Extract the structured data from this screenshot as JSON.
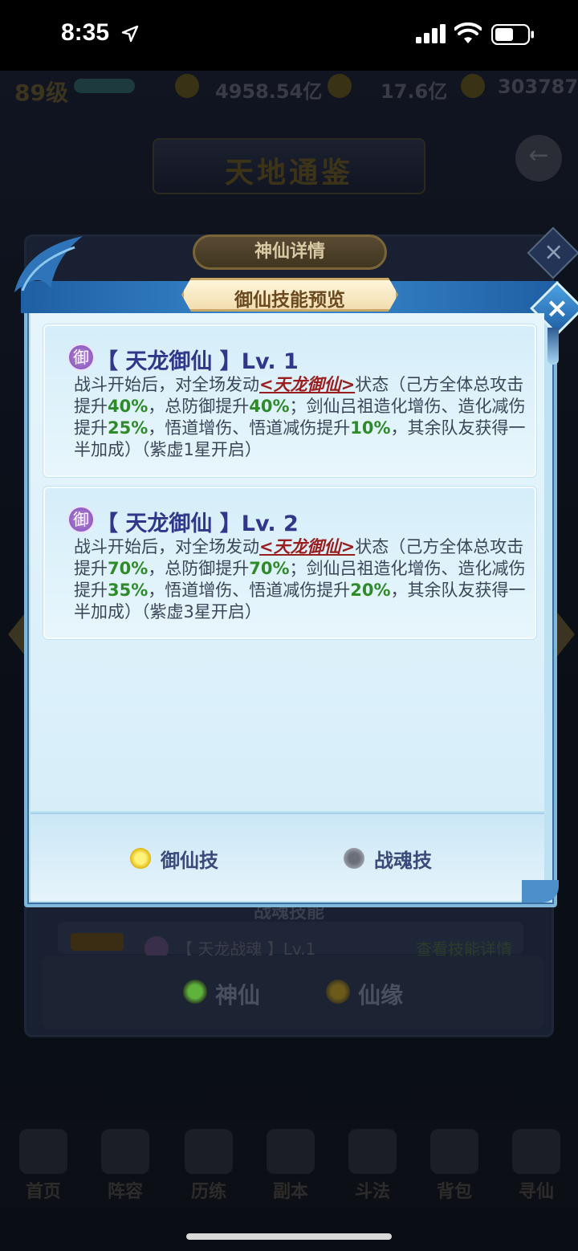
{
  "status_bar": {
    "time": "8:35",
    "icons": [
      "location-arrow-icon",
      "cellular-signal-icon",
      "wifi-icon",
      "battery-icon"
    ]
  },
  "hud": {
    "level": "89级",
    "gold": "4958.54亿",
    "currency2": "17.6亿",
    "currency3": "303787"
  },
  "background_screen": {
    "title": "天地通鉴",
    "dialog_title": "神仙详情",
    "section_title": "战魂技能",
    "row_badge": "战",
    "row_label": "【 天龙战魂 】Lv.1",
    "row_link": "查看技能详情",
    "tabs": [
      {
        "label": "神仙",
        "active": true
      },
      {
        "label": "仙缘",
        "active": false
      }
    ],
    "nav": [
      "首页",
      "阵容",
      "历练",
      "副本",
      "斗法",
      "背包",
      "寻仙"
    ]
  },
  "dialog": {
    "title": "御仙技能预览",
    "close_label": "×",
    "skills": [
      {
        "badge": "御",
        "title": "【 天龙御仙 】Lv. 1",
        "desc_parts": [
          {
            "t": "战斗开始后，对全场发动",
            "s": ""
          },
          {
            "t": "<天龙御仙>",
            "s": "hl-red"
          },
          {
            "t": "状态（己方全体总攻击提升",
            "s": ""
          },
          {
            "t": "40%",
            "s": "hl-green"
          },
          {
            "t": "，总防御提升",
            "s": ""
          },
          {
            "t": "40%",
            "s": "hl-green"
          },
          {
            "t": "；剑仙吕祖造化增伤、造化减伤提升",
            "s": ""
          },
          {
            "t": "25%",
            "s": "hl-green"
          },
          {
            "t": "，悟道增伤、悟道减伤提升",
            "s": ""
          },
          {
            "t": "10%",
            "s": "hl-green"
          },
          {
            "t": "，其余队友获得一半加成）（紫虚1星开启）",
            "s": ""
          }
        ]
      },
      {
        "badge": "御",
        "title": "【 天龙御仙 】Lv. 2",
        "desc_parts": [
          {
            "t": "战斗开始后，对全场发动",
            "s": ""
          },
          {
            "t": "<天龙御仙>",
            "s": "hl-red"
          },
          {
            "t": "状态（己方全体总攻击提升",
            "s": ""
          },
          {
            "t": "70%",
            "s": "hl-green"
          },
          {
            "t": "，总防御提升",
            "s": ""
          },
          {
            "t": "70%",
            "s": "hl-green"
          },
          {
            "t": "；剑仙吕祖造化增伤、造化减伤提升",
            "s": ""
          },
          {
            "t": "35%",
            "s": "hl-green"
          },
          {
            "t": "，悟道增伤、悟道减伤提升",
            "s": ""
          },
          {
            "t": "20%",
            "s": "hl-green"
          },
          {
            "t": "，其余队友获得一半加成）（紫虚3星开启）",
            "s": ""
          }
        ]
      }
    ],
    "tabs": [
      {
        "label": "御仙技",
        "selected": true
      },
      {
        "label": "战魂技",
        "selected": false
      }
    ]
  },
  "colors": {
    "accent_blue": "#1f5fa3",
    "title_gold": "#c9a867",
    "highlight_red": "#9a1e1e",
    "highlight_green": "#2f8a2a",
    "skill_title": "#30378a"
  }
}
